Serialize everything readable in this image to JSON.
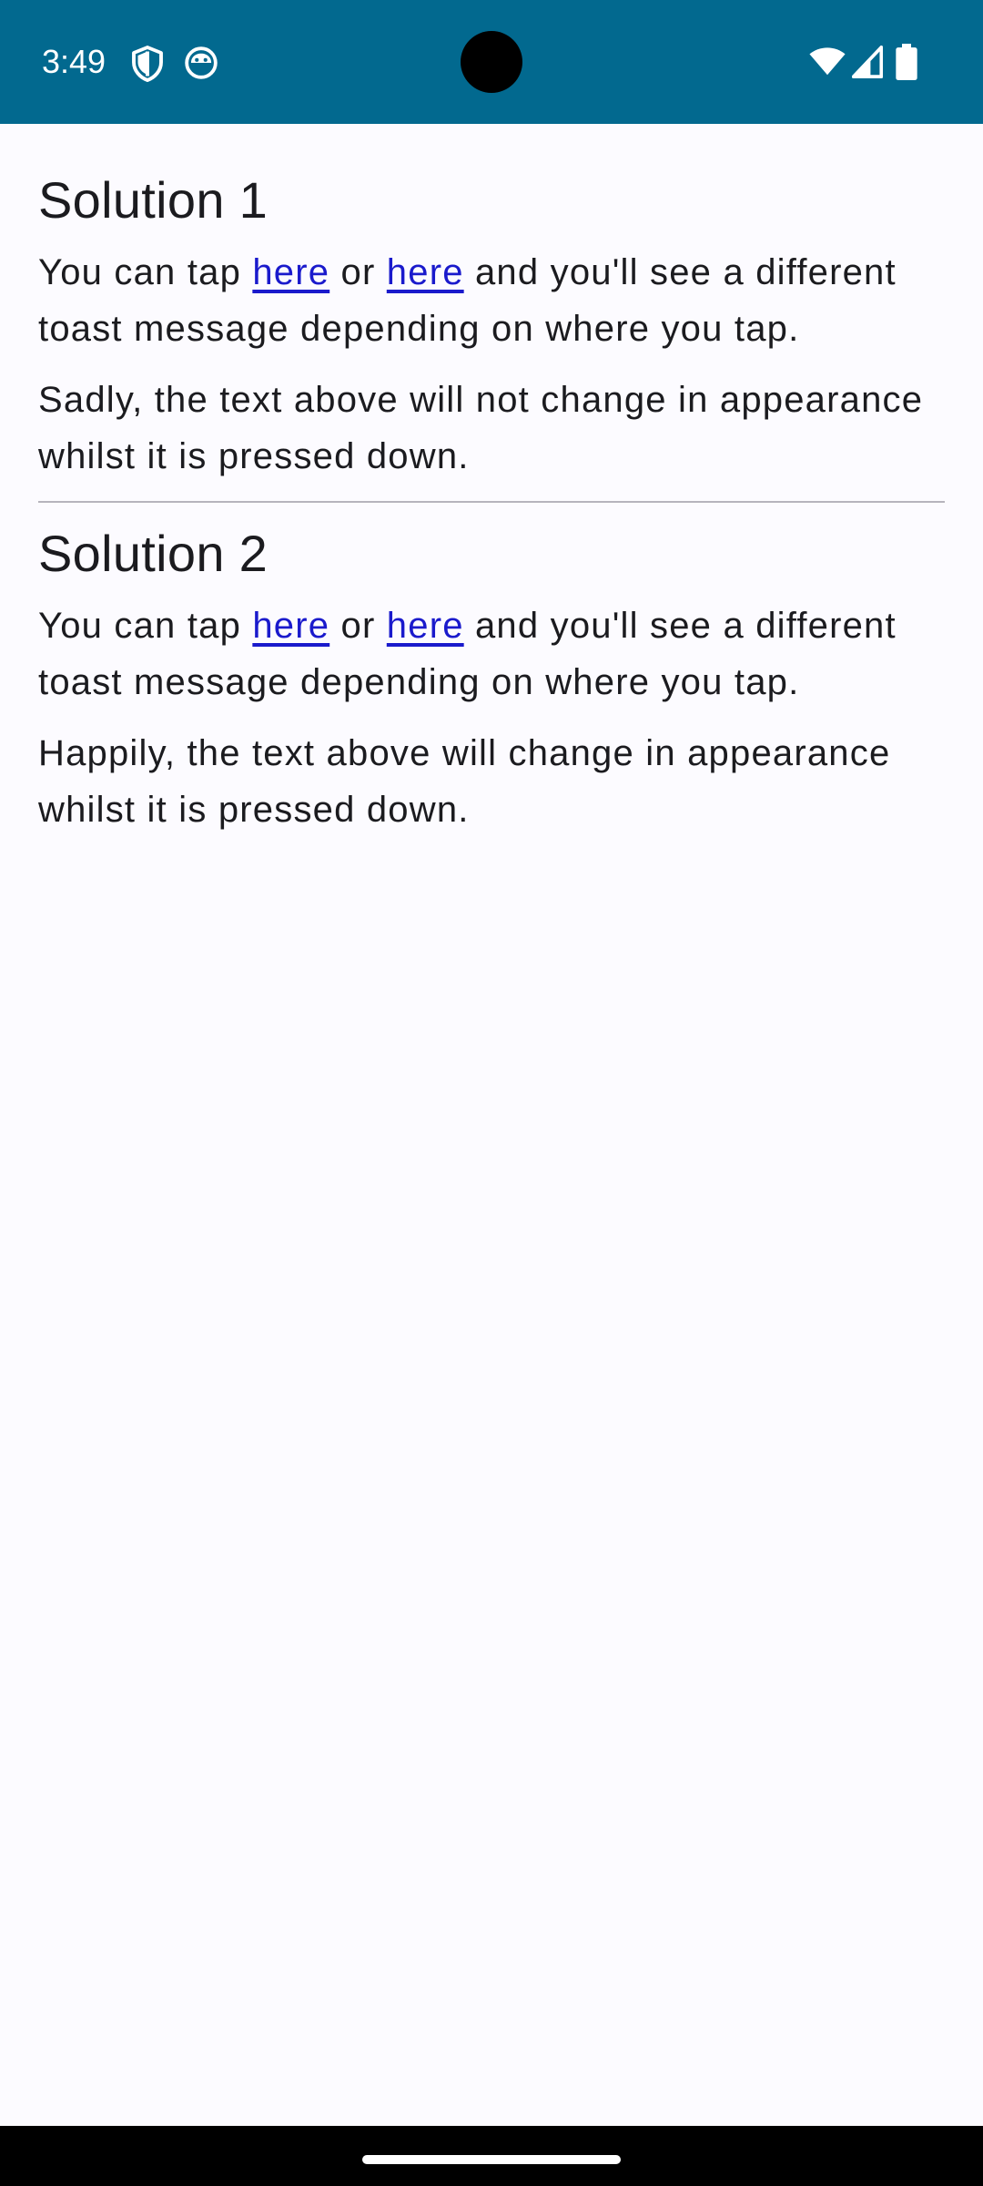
{
  "status_bar": {
    "time": "3:49",
    "icons_left": [
      "shield-icon",
      "android-face-icon"
    ],
    "icons_right": [
      "wifi-icon",
      "signal-icon",
      "battery-icon"
    ],
    "background": "#02698f"
  },
  "solution1": {
    "title": "Solution 1",
    "line1": {
      "before": "You can tap ",
      "link1": "here",
      "middle": " or ",
      "link2": "here",
      "after": " and you'll see a different toast message depending on where you tap."
    },
    "note": "Sadly, the text above will not change in appearance whilst it is pressed down."
  },
  "solution2": {
    "title": "Solution 2",
    "line1": {
      "before": "You can tap ",
      "link1": "here",
      "middle": " or ",
      "link2": "here",
      "after": " and you'll see a different toast message depending on where you tap."
    },
    "note": "Happily, the text above will change in appearance whilst it is pressed down."
  },
  "colors": {
    "link": "#1a1acc",
    "text": "#1b1b1f",
    "divider": "#b6b4bd",
    "background": "#fcfbff"
  }
}
